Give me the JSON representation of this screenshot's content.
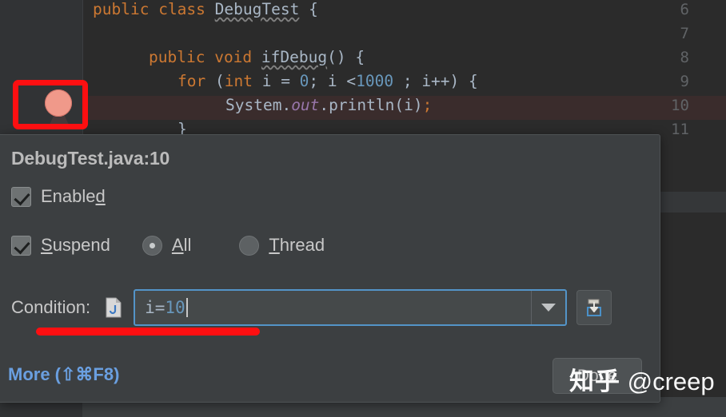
{
  "editor": {
    "line_numbers": [
      "6",
      "7",
      "8",
      "9",
      "10",
      "11"
    ],
    "lines": [
      {
        "num": "6",
        "text": "public class DebugTest {"
      },
      {
        "num": "7",
        "text": ""
      },
      {
        "num": "8",
        "text": "    public void ifDebug() {"
      },
      {
        "num": "9",
        "text": "        for (int i = 0; i <1000 ; i++) {"
      },
      {
        "num": "10",
        "text": "            System.out.println(i);"
      },
      {
        "num": "11",
        "text": "        }"
      }
    ],
    "tokens": {
      "l6_kw1": "public",
      "l6_kw2": "class",
      "l6_cls": "DebugTest",
      "l6_brace": "{",
      "l8_kw1": "public",
      "l8_kw2": "void",
      "l8_mth": "ifDebug",
      "l8_tail": "() {",
      "l9_kw": "for",
      "l9_p1": "(",
      "l9_int": "int",
      "l9_v": " i = ",
      "l9_zero": "0",
      "l9_mid": "; i <",
      "l9_thousand": "1000",
      "l9_tail": " ; i++) {",
      "l10_a": "System.",
      "l10_out": "out",
      "l10_b": ".println(i)",
      "l10_semi": ";",
      "l11": "}"
    },
    "breakpoint_line": "10",
    "highlight_line": "10"
  },
  "dialog": {
    "title": "DebugTest.java:10",
    "enabled": {
      "label_pre": "Enable",
      "label_mnemonic": "d",
      "checked": true
    },
    "suspend": {
      "label_mnemonic": "S",
      "label_post": "uspend",
      "checked": true
    },
    "all_radio": {
      "label_mnemonic": "A",
      "label_post": "ll",
      "selected": true
    },
    "thread_radio": {
      "label_mnemonic": "T",
      "label_post": "hread",
      "selected": false
    },
    "condition": {
      "label": "Condition:",
      "value": "i=10",
      "value_ident": "i=",
      "value_num": "10",
      "placeholder": "",
      "file_icon": "java-file-icon",
      "dropdown_icon": "chevron-down-icon",
      "expand_icon": "expand-editor-icon"
    },
    "more_link": "More (⇧⌘F8)",
    "done_button": "Done"
  },
  "annotations": {
    "color": "#fd0f11",
    "rect_target": "breakpoint-gutter",
    "underline_target": "condition-field"
  },
  "watermark": {
    "logo": "知乎",
    "handle": "@creep"
  },
  "colors": {
    "editor_bg": "#2b2b2b",
    "gutter_bg": "#313335",
    "dialog_bg": "#3c3f41",
    "accent_blue": "#5394c8",
    "link_blue": "#6a9fe0",
    "keyword_orange": "#cc7832",
    "number_blue": "#6897bb",
    "field_purple": "#9876aa",
    "breakpoint_red": "#f0998a",
    "annotation_red": "#fd0f11"
  }
}
